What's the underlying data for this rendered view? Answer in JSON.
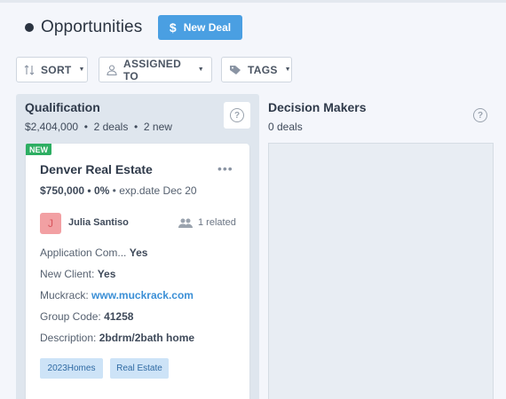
{
  "header": {
    "title": "Opportunities",
    "new_deal_label": "New Deal",
    "new_deal_icon": "dollar-icon"
  },
  "filters": {
    "sort": "SORT",
    "assigned": "ASSIGNED TO",
    "tags": "TAGS"
  },
  "columns": [
    {
      "title": "Qualification",
      "amount": "$2,404,000",
      "deals": "2 deals",
      "new": "2 new"
    },
    {
      "title": "Decision Makers",
      "deals": "0 deals"
    }
  ],
  "card": {
    "badge": "NEW",
    "title": "Denver Real Estate",
    "amount": "$750,000",
    "percent": "0%",
    "exp": "exp.date Dec 20",
    "avatar_initial": "J",
    "owner": "Julia Santiso",
    "related": "1 related",
    "fields": [
      {
        "label": "Application Com...",
        "value": "Yes"
      },
      {
        "label": "New Client:",
        "value": "Yes"
      },
      {
        "label": "Muckrack:",
        "value": "www.muckrack.com"
      },
      {
        "label": "Group Code:",
        "value": "41258"
      },
      {
        "label": "Description:",
        "value": "2bdrm/2bath home"
      }
    ],
    "tags": [
      "2023Homes",
      "Real Estate"
    ]
  },
  "colors": {
    "accent": "#4a9fe2",
    "new_badge": "#2dae62",
    "link": "#3b8fd6",
    "tag_bg": "#cde3f7",
    "avatar_bg": "#f2a0a3"
  }
}
